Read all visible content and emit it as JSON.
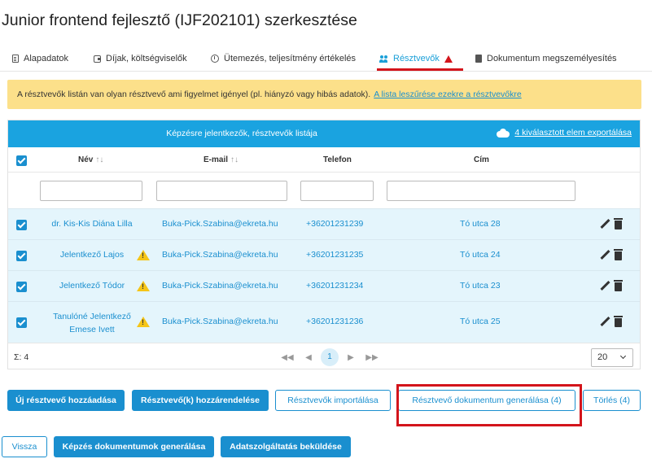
{
  "page": {
    "title": "Junior frontend fejlesztő (IJF202101) szerkesztése"
  },
  "tabs": [
    {
      "label": "Alapadatok",
      "icon": "document-icon"
    },
    {
      "label": "Díjak, költségviselők",
      "icon": "wallet-icon"
    },
    {
      "label": "Ütemezés, teljesítmény értékelés",
      "icon": "clock-icon"
    },
    {
      "label": "Résztvevők",
      "icon": "people-icon",
      "active": true
    },
    {
      "label": "Dokumentum megszemélyesítés",
      "icon": "book-icon"
    }
  ],
  "alert": {
    "text": "A résztvevők listán van olyan résztvevő ami figyelmet igényel (pl. hiányzó vagy hibás adatok).",
    "link": "A lista leszűrése ezekre a résztvevőkre"
  },
  "grid": {
    "title": "Képzésre jelentkezők, résztvevők listája",
    "export_label": "4 kiválasztott elem exportálása",
    "columns": {
      "name": "Név",
      "email": "E-mail",
      "phone": "Telefon",
      "address": "Cím"
    },
    "rows": [
      {
        "name": "dr. Kis-Kis Diána Lilla",
        "email": "Buka-Pick.Szabina@ekreta.hu",
        "phone": "+36201231239",
        "address": "Tó utca 28",
        "warning": false
      },
      {
        "name": "Jelentkező Lajos",
        "email": "Buka-Pick.Szabina@ekreta.hu",
        "phone": "+36201231235",
        "address": "Tó utca 24",
        "warning": true
      },
      {
        "name": "Jelentkező Tódor",
        "email": "Buka-Pick.Szabina@ekreta.hu",
        "phone": "+36201231234",
        "address": "Tó utca 23",
        "warning": true
      },
      {
        "name_line1": "Tanulóné Jelentkező",
        "name_line2": "Emese Ivett",
        "email": "Buka-Pick.Szabina@ekreta.hu",
        "phone": "+36201231236",
        "address": "Tó utca 25",
        "warning": true
      }
    ],
    "footer": {
      "sum": "Σ: 4",
      "current_page": "1",
      "page_size": "20"
    }
  },
  "actions": {
    "add": "Új résztvevő hozzáadása",
    "assign": "Résztvevő(k) hozzárendelése",
    "import": "Résztvevők importálása",
    "generate": "Résztvevő dokumentum generálása (4)",
    "delete": "Törlés (4)"
  },
  "bottom": {
    "back": "Vissza",
    "generate_docs": "Képzés dokumentumok generálása",
    "submit": "Adatszolgáltatás beküldése"
  }
}
